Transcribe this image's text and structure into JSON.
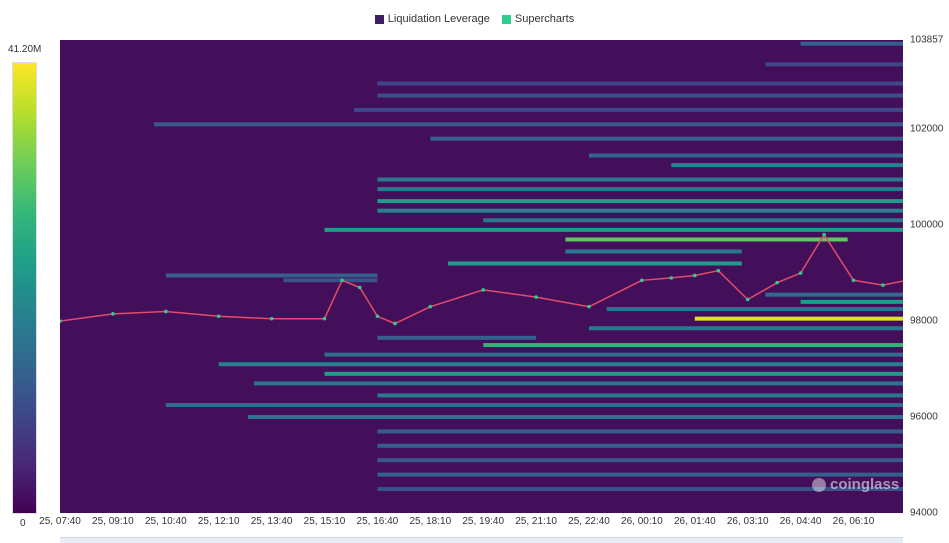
{
  "legend": {
    "items": [
      {
        "label": "Liquidation Leverage",
        "color": "#3b1f5e"
      },
      {
        "label": "Supercharts",
        "color": "#2ecc8f"
      }
    ]
  },
  "colorbar": {
    "max_label": "41.20M",
    "min_label": "0",
    "colors": [
      "#fde725",
      "#b5de2b",
      "#6ece58",
      "#35b779",
      "#1f9e89",
      "#26828e",
      "#31688e",
      "#3e4989",
      "#482878",
      "#440154"
    ]
  },
  "watermark": {
    "text": "coinglass"
  },
  "chart_data": {
    "type": "heatmap",
    "title": "",
    "xlabel": "",
    "ylabel": "",
    "background_color": "#440f5a",
    "ylim": [
      94000,
      103857
    ],
    "x_ticks": [
      "25, 07:40",
      "25, 09:10",
      "25, 10:40",
      "25, 12:10",
      "25, 13:40",
      "25, 15:10",
      "25, 16:40",
      "25, 18:10",
      "25, 19:40",
      "25, 21:10",
      "25, 22:40",
      "26, 00:10",
      "26, 01:40",
      "26, 03:10",
      "26, 04:40",
      "26, 06:10"
    ],
    "y_ticks": [
      94000,
      96000,
      98000,
      100000,
      102000,
      103857
    ],
    "liquidation_levels": [
      {
        "price": 103780,
        "start": "26, 04:40",
        "end": "26, 07:40",
        "intensity": 0.3
      },
      {
        "price": 103350,
        "start": "26, 03:40",
        "end": "26, 07:40",
        "intensity": 0.22
      },
      {
        "price": 102950,
        "start": "25, 16:40",
        "end": "26, 07:40",
        "intensity": 0.22
      },
      {
        "price": 102700,
        "start": "25, 16:40",
        "end": "26, 07:40",
        "intensity": 0.25
      },
      {
        "price": 102400,
        "start": "25, 16:00",
        "end": "26, 07:40",
        "intensity": 0.22
      },
      {
        "price": 102100,
        "start": "25, 10:20",
        "end": "26, 07:40",
        "intensity": 0.28
      },
      {
        "price": 101800,
        "start": "25, 18:10",
        "end": "26, 07:40",
        "intensity": 0.3
      },
      {
        "price": 101450,
        "start": "25, 22:40",
        "end": "26, 07:40",
        "intensity": 0.32
      },
      {
        "price": 101250,
        "start": "26, 01:00",
        "end": "26, 07:40",
        "intensity": 0.45
      },
      {
        "price": 100950,
        "start": "25, 16:40",
        "end": "26, 07:40",
        "intensity": 0.4
      },
      {
        "price": 100750,
        "start": "25, 16:40",
        "end": "26, 07:40",
        "intensity": 0.4
      },
      {
        "price": 100500,
        "start": "25, 16:40",
        "end": "26, 07:40",
        "intensity": 0.55
      },
      {
        "price": 100300,
        "start": "25, 16:40",
        "end": "26, 07:40",
        "intensity": 0.45
      },
      {
        "price": 100100,
        "start": "25, 19:40",
        "end": "26, 07:40",
        "intensity": 0.4
      },
      {
        "price": 99900,
        "start": "25, 15:10",
        "end": "26, 07:40",
        "intensity": 0.55
      },
      {
        "price": 99700,
        "start": "25, 22:00",
        "end": "26, 06:00",
        "intensity": 0.75
      },
      {
        "price": 99450,
        "start": "25, 22:00",
        "end": "26, 03:00",
        "intensity": 0.4
      },
      {
        "price": 99200,
        "start": "25, 18:40",
        "end": "26, 03:00",
        "intensity": 0.55
      },
      {
        "price": 98950,
        "start": "25, 10:40",
        "end": "25, 16:40",
        "intensity": 0.3
      },
      {
        "price": 98850,
        "start": "25, 14:00",
        "end": "25, 16:40",
        "intensity": 0.25
      },
      {
        "price": 98550,
        "start": "26, 03:40",
        "end": "26, 07:40",
        "intensity": 0.35
      },
      {
        "price": 98400,
        "start": "26, 04:40",
        "end": "26, 07:40",
        "intensity": 0.55
      },
      {
        "price": 98250,
        "start": "25, 23:10",
        "end": "26, 07:40",
        "intensity": 0.38
      },
      {
        "price": 98050,
        "start": "26, 01:40",
        "end": "26, 07:40",
        "intensity": 0.95
      },
      {
        "price": 97850,
        "start": "25, 22:40",
        "end": "26, 07:40",
        "intensity": 0.4
      },
      {
        "price": 97650,
        "start": "25, 16:40",
        "end": "25, 21:10",
        "intensity": 0.3
      },
      {
        "price": 97500,
        "start": "25, 19:40",
        "end": "26, 07:40",
        "intensity": 0.65
      },
      {
        "price": 97300,
        "start": "25, 15:10",
        "end": "26, 07:40",
        "intensity": 0.35
      },
      {
        "price": 97100,
        "start": "25, 12:10",
        "end": "26, 07:40",
        "intensity": 0.45
      },
      {
        "price": 96900,
        "start": "25, 15:10",
        "end": "26, 07:40",
        "intensity": 0.55
      },
      {
        "price": 96700,
        "start": "25, 13:10",
        "end": "26, 07:40",
        "intensity": 0.4
      },
      {
        "price": 96450,
        "start": "25, 16:40",
        "end": "26, 07:40",
        "intensity": 0.4
      },
      {
        "price": 96250,
        "start": "25, 10:40",
        "end": "26, 07:40",
        "intensity": 0.35
      },
      {
        "price": 96000,
        "start": "25, 13:00",
        "end": "26, 07:40",
        "intensity": 0.38
      },
      {
        "price": 95700,
        "start": "25, 16:40",
        "end": "26, 07:40",
        "intensity": 0.3
      },
      {
        "price": 95400,
        "start": "25, 16:40",
        "end": "26, 07:40",
        "intensity": 0.3
      },
      {
        "price": 95100,
        "start": "25, 16:40",
        "end": "26, 07:40",
        "intensity": 0.28
      },
      {
        "price": 94800,
        "start": "25, 16:40",
        "end": "26, 07:40",
        "intensity": 0.3
      },
      {
        "price": 94500,
        "start": "25, 16:40",
        "end": "26, 07:40",
        "intensity": 0.25
      }
    ],
    "price_line": {
      "x": [
        "25, 07:40",
        "25, 09:10",
        "25, 10:40",
        "25, 12:10",
        "25, 13:40",
        "25, 15:10",
        "25, 15:40",
        "25, 16:10",
        "25, 16:40",
        "25, 17:10",
        "25, 18:10",
        "25, 19:40",
        "25, 21:10",
        "25, 22:40",
        "26, 00:10",
        "26, 01:00",
        "26, 01:40",
        "26, 02:20",
        "26, 03:10",
        "26, 04:00",
        "26, 04:40",
        "26, 05:20",
        "26, 06:10",
        "26, 07:00",
        "26, 07:40"
      ],
      "y": [
        98000,
        98150,
        98200,
        98100,
        98050,
        98050,
        98850,
        98700,
        98100,
        97950,
        98300,
        98650,
        98500,
        98300,
        98850,
        98900,
        98950,
        99050,
        98450,
        98800,
        99000,
        99800,
        98850,
        98750,
        98850
      ]
    }
  }
}
